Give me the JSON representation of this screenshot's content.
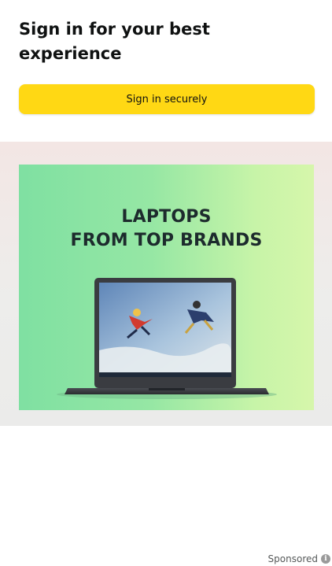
{
  "signin": {
    "title": "Sign in for your best experience",
    "button_label": "Sign in securely",
    "button_color": "#ffd814"
  },
  "ad": {
    "headline_line1": "LAPTOPS",
    "headline_line2": "FROM TOP BRANDS",
    "image_subject": "laptop-showing-skydivers",
    "sponsored_label": "Sponsored",
    "info_icon": "info-icon"
  }
}
